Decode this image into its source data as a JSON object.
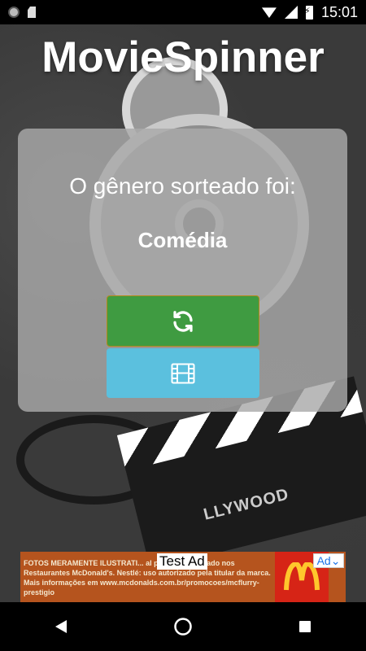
{
  "status_bar": {
    "time": "15:01",
    "icons": [
      "notification-dot-icon",
      "sd-card-icon",
      "wifi-icon",
      "signal-icon",
      "battery-charging-icon"
    ]
  },
  "app": {
    "title": "MovieSpinner"
  },
  "card": {
    "prompt": "O gênero sorteado foi:",
    "genre": "Comédia",
    "spin_button": {
      "icon": "refresh-icon",
      "color": "#3f9b41"
    },
    "movie_button": {
      "icon": "film-icon",
      "color": "#5bc0de"
    }
  },
  "background": {
    "clapper_text": "LLYWOOD"
  },
  "ad": {
    "label": "Test Ad",
    "choice_label": "Ad",
    "body_text": "FOTOS MERAMENTE ILUSTRATI... al por tempo limitado nos Restaurantes McDonald's. Nestlé: uso autorizado pela titular da marca. Mais informações em www.mcdonalds.com.br/promocoes/mcflurry-prestigio",
    "logo": "M"
  },
  "nav_bar": {
    "buttons": [
      "back-icon",
      "home-icon",
      "recents-icon"
    ]
  }
}
